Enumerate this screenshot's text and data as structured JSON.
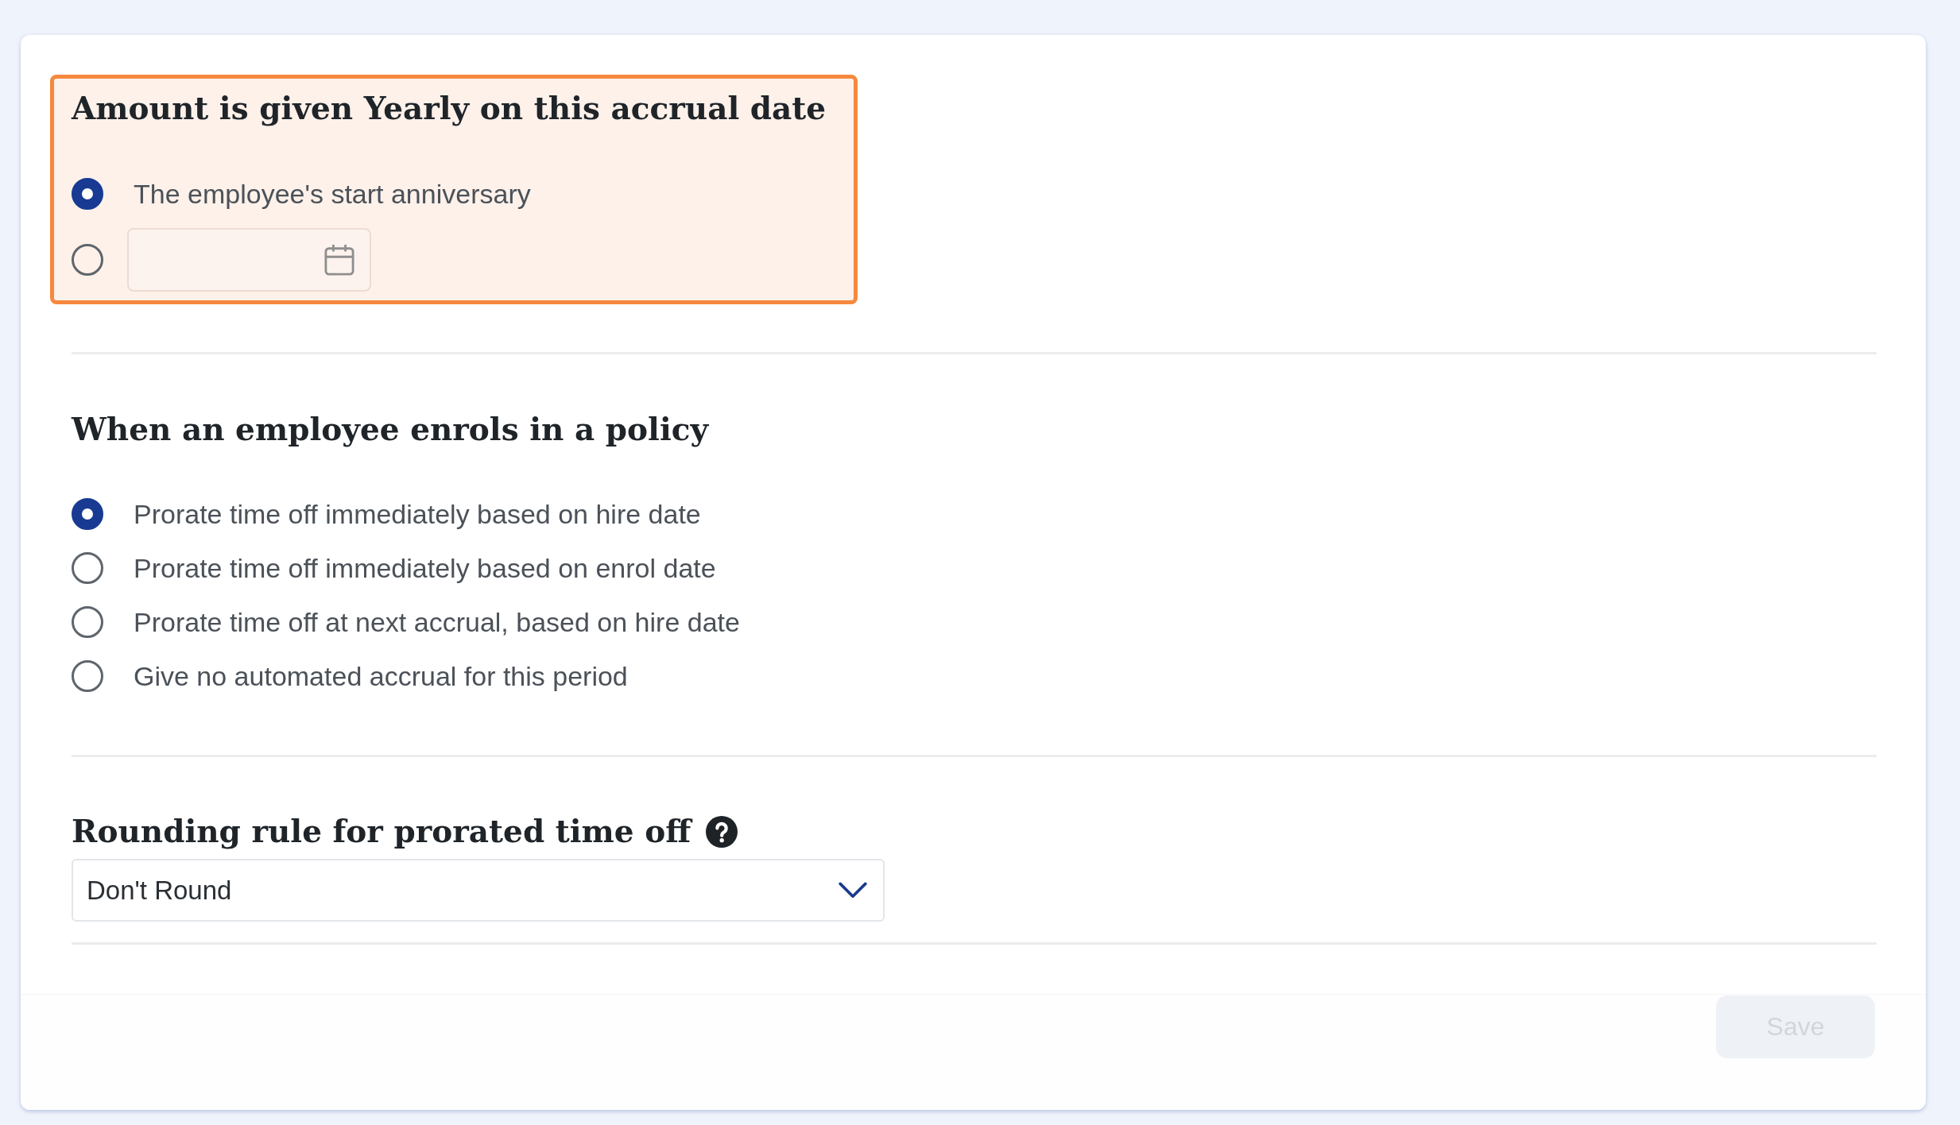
{
  "accrual_date": {
    "highlighted": true,
    "title": "Amount is given Yearly on this accrual date",
    "options": [
      {
        "kind": "label",
        "label": "The employee's start anniversary",
        "selected": true
      },
      {
        "kind": "date",
        "selected": false
      }
    ]
  },
  "enrolment": {
    "title": "When an employee enrols in a policy",
    "options": [
      {
        "label": "Prorate time off immediately based on hire date",
        "selected": true
      },
      {
        "label": "Prorate time off immediately based on enrol date",
        "selected": false
      },
      {
        "label": "Prorate time off at next accrual, based on hire date",
        "selected": false
      },
      {
        "label": "Give no automated accrual for this period",
        "selected": false
      }
    ]
  },
  "rounding": {
    "title": "Rounding rule for prorated time off",
    "select": {
      "value": "Don't Round"
    }
  },
  "save_button": {
    "label": "Save",
    "disabled": true
  }
}
